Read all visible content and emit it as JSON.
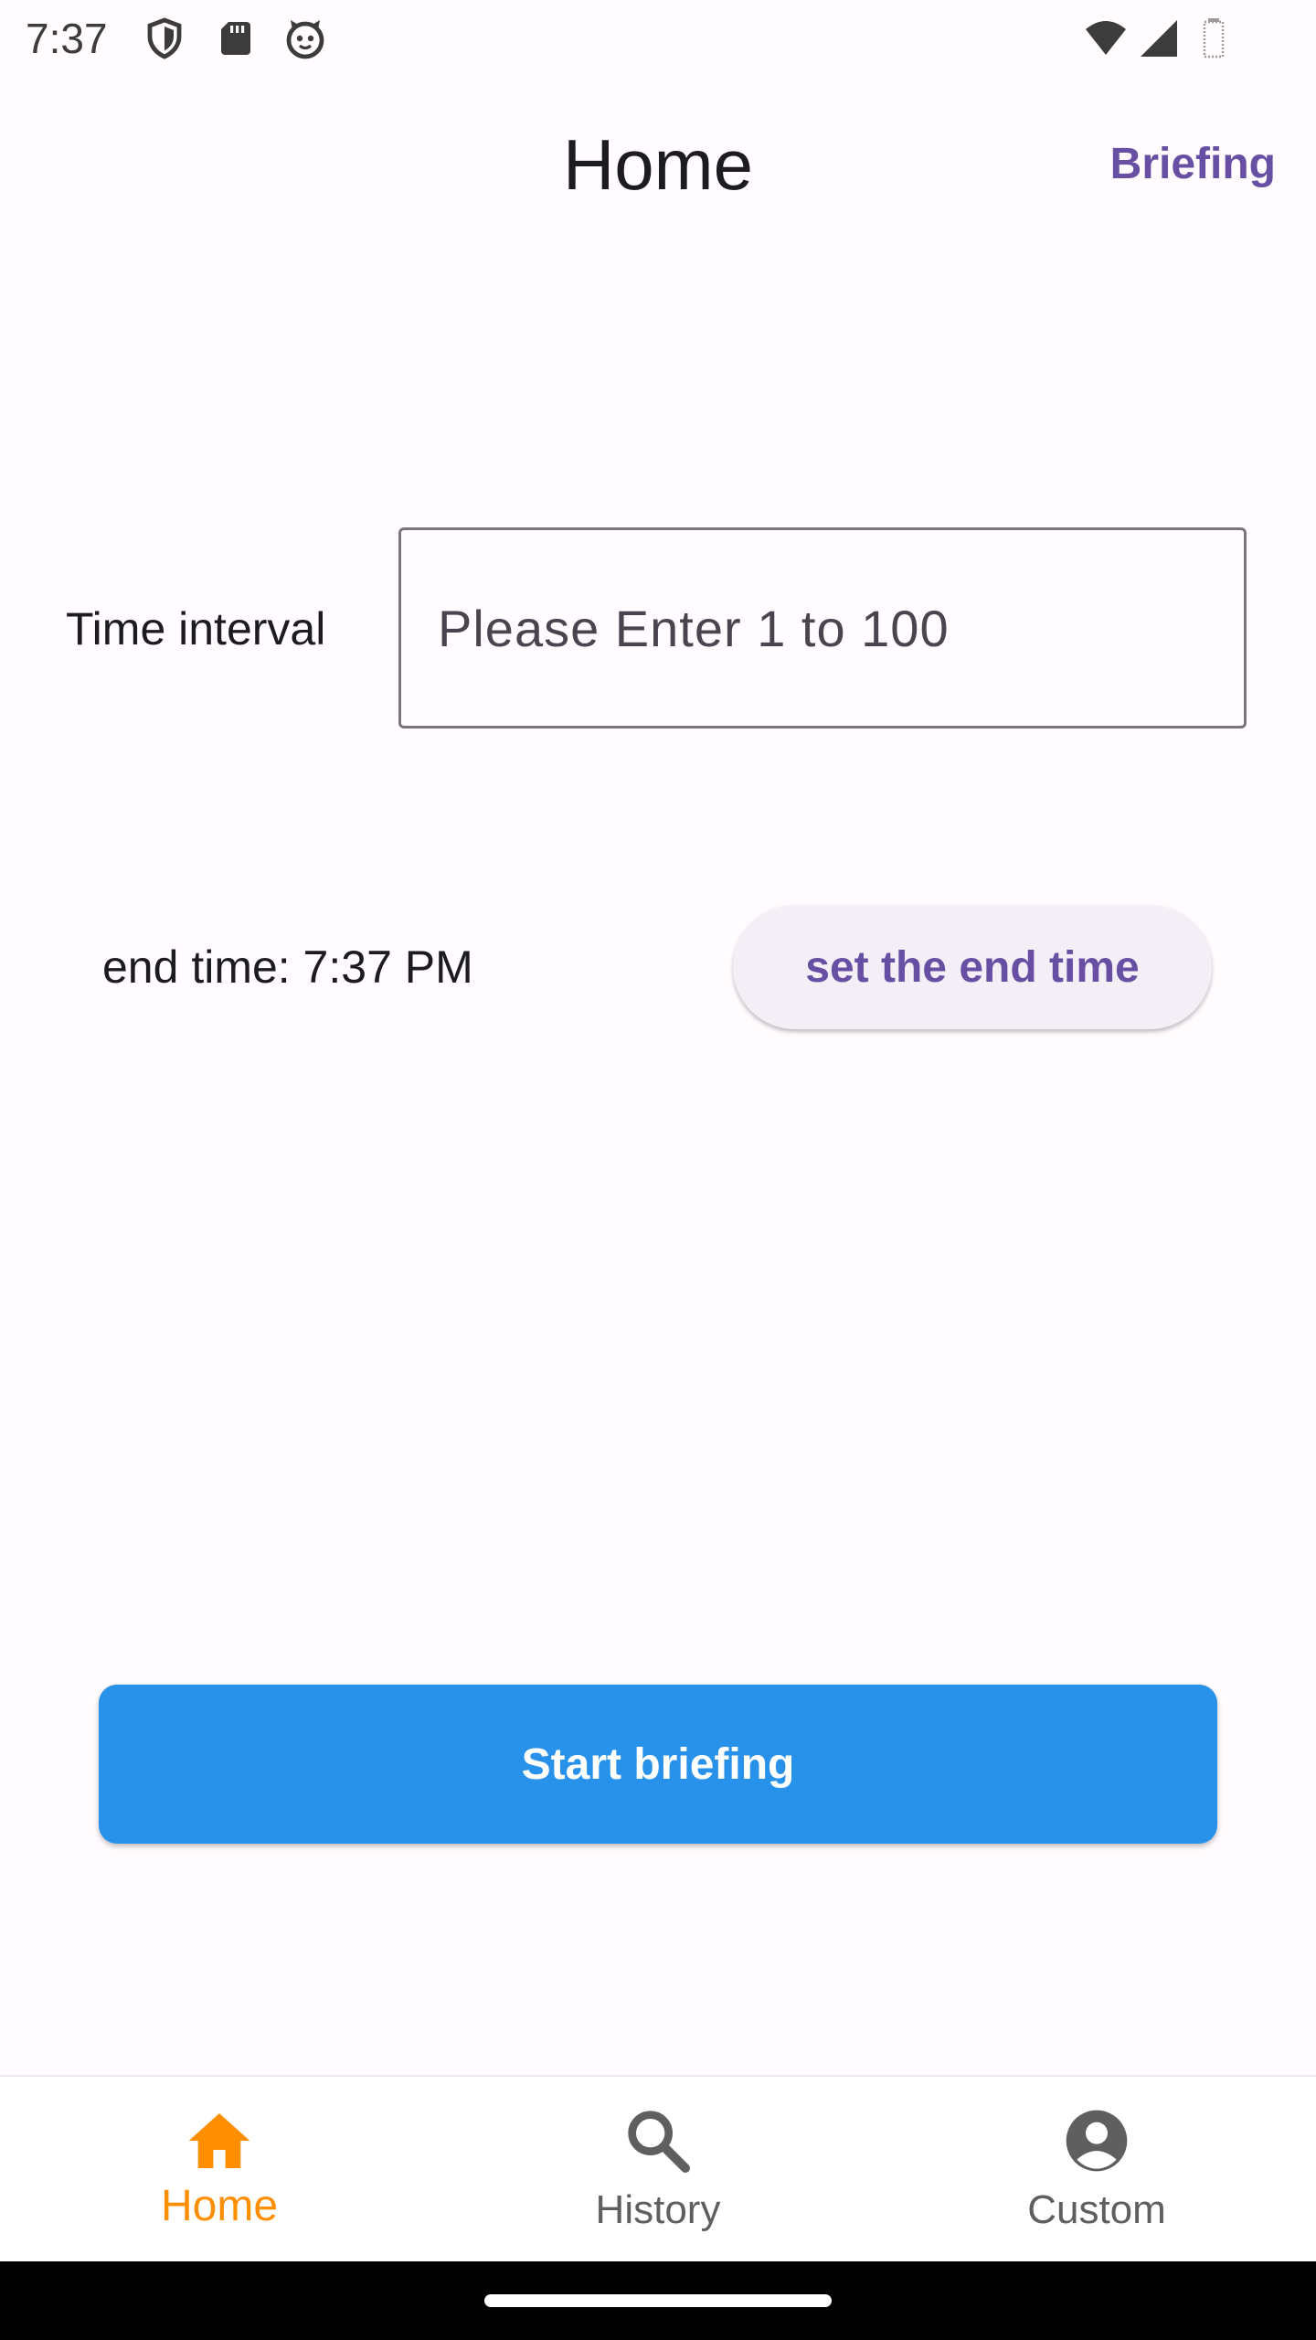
{
  "status_bar": {
    "time": "7:37",
    "left_icons": [
      "shield-icon",
      "sd-card-icon",
      "face-icon"
    ],
    "right_icons": [
      "wifi-icon",
      "signal-icon",
      "battery-icon"
    ]
  },
  "app_bar": {
    "title": "Home",
    "action_label": "Briefing"
  },
  "time_interval": {
    "label": "Time interval",
    "placeholder": "Please Enter 1 to 100",
    "value": ""
  },
  "end_time": {
    "label": "end time: 7:37 PM",
    "button_label": "set the end time"
  },
  "start_button": {
    "label": "Start briefing"
  },
  "bottom_nav": {
    "items": [
      {
        "label": "Home",
        "icon": "home-icon",
        "active": true
      },
      {
        "label": "History",
        "icon": "search-icon",
        "active": false
      },
      {
        "label": "Custom",
        "icon": "account-icon",
        "active": false
      }
    ]
  },
  "colors": {
    "accent": "#6750a4",
    "primary_button": "#2892eb",
    "active_nav": "#ff8f00",
    "inactive_nav": "#5f5f5f",
    "background": "#fffbfe"
  }
}
